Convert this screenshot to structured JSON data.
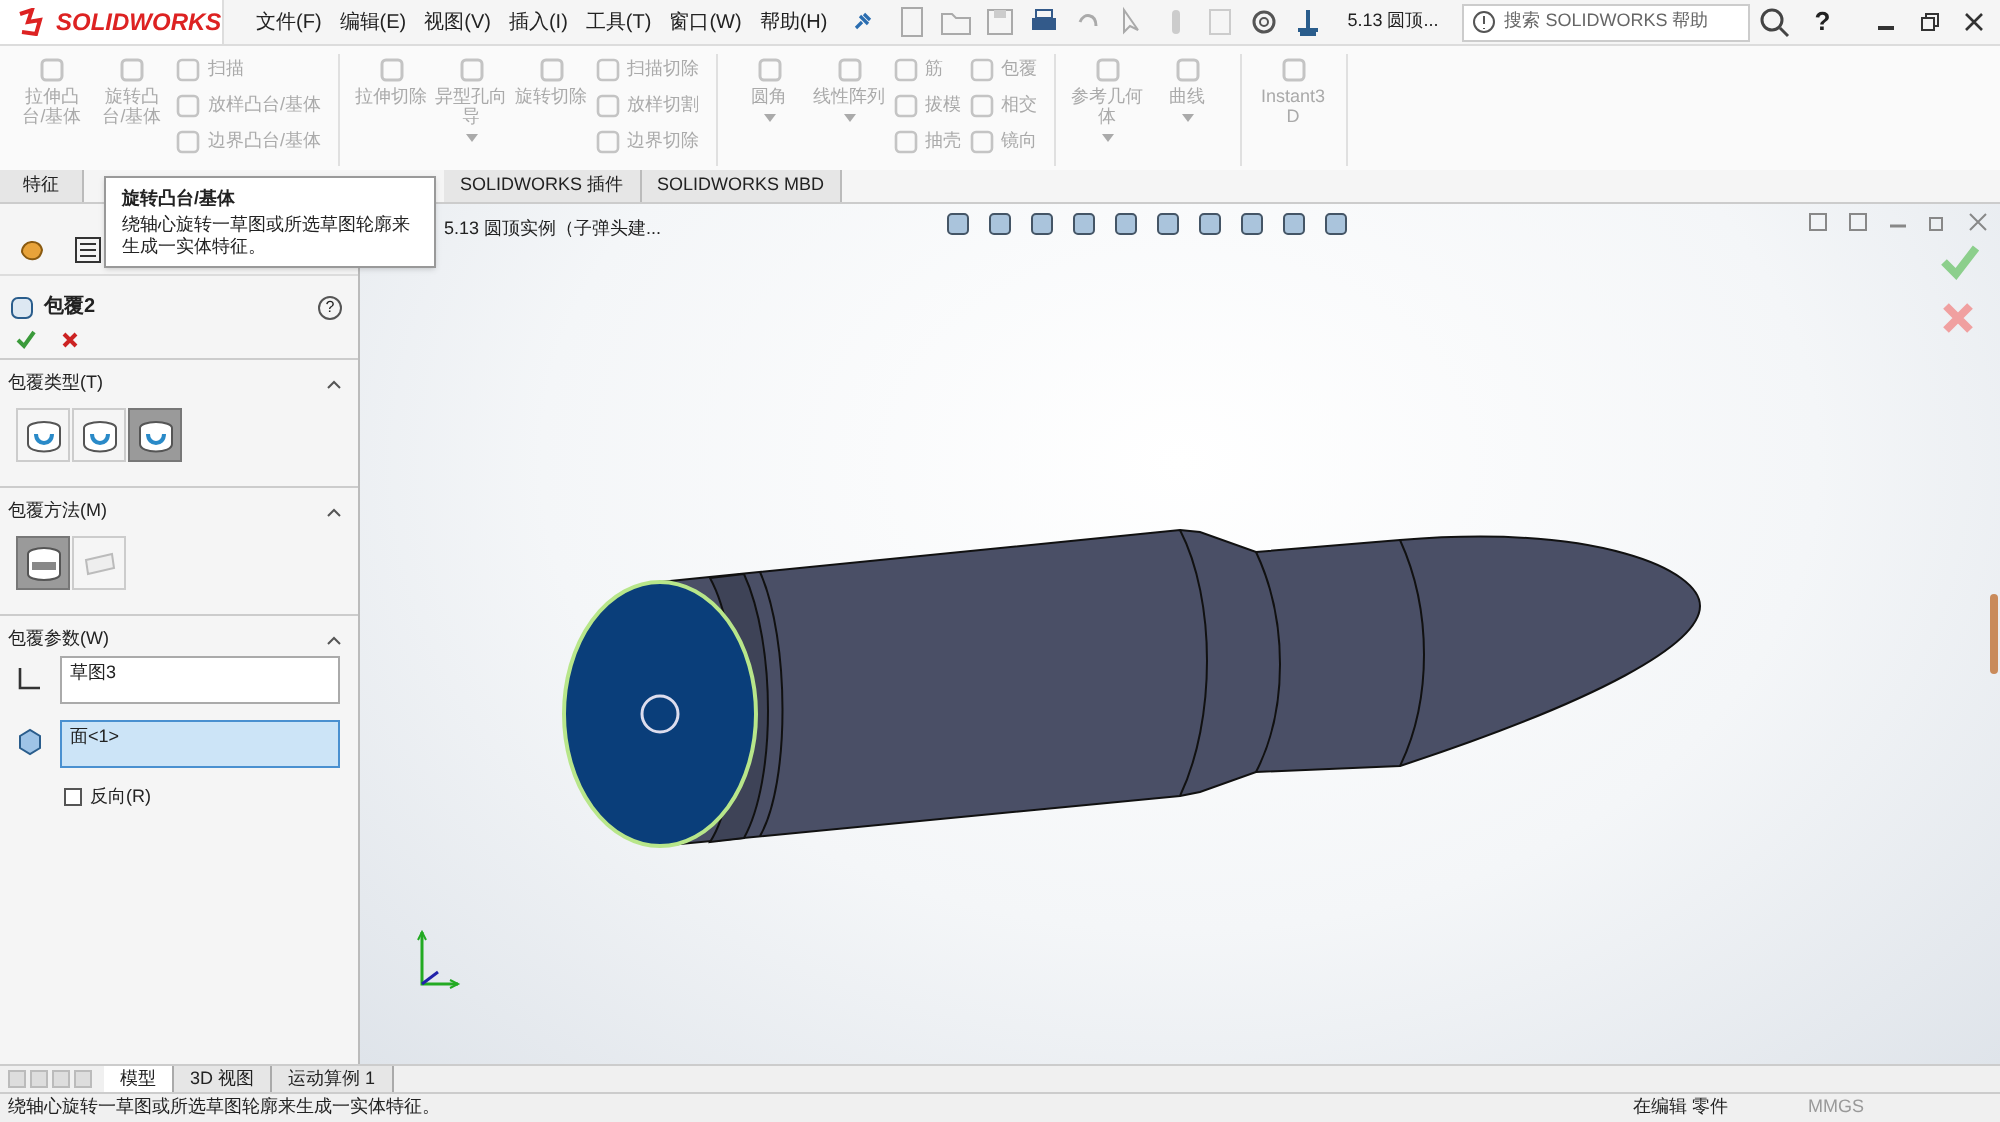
{
  "app": {
    "logo": "SOLIDWORKS",
    "menus": [
      "文件(F)",
      "编辑(E)",
      "视图(V)",
      "插入(I)",
      "工具(T)",
      "窗口(W)",
      "帮助(H)"
    ],
    "document_title": "5.13 圆顶...",
    "search": {
      "placeholder": "搜索 SOLIDWORKS 帮助"
    },
    "help": "?"
  },
  "ribbon": {
    "groups": [
      {
        "items": [
          {
            "kind": "large",
            "label": "拉伸凸台/基体",
            "disabled": true
          },
          {
            "kind": "large",
            "label": "旋转凸台/基体",
            "disabled": true
          },
          {
            "kind": "column",
            "children": [
              {
                "label": "扫描",
                "disabled": true
              },
              {
                "label": "放样凸台/基体",
                "disabled": true
              },
              {
                "label": "边界凸台/基体",
                "disabled": true
              }
            ]
          }
        ]
      },
      {
        "items": [
          {
            "kind": "large",
            "label": "拉伸切除",
            "disabled": true
          },
          {
            "kind": "large",
            "label": "异型孔向导",
            "disabled": true,
            "dropdown": true
          },
          {
            "kind": "large",
            "label": "旋转切除",
            "disabled": true
          },
          {
            "kind": "column",
            "children": [
              {
                "label": "扫描切除",
                "disabled": true
              },
              {
                "label": "放样切割",
                "disabled": true
              },
              {
                "label": "边界切除",
                "disabled": true
              }
            ]
          }
        ]
      },
      {
        "items": [
          {
            "kind": "large",
            "label": "圆角",
            "disabled": true,
            "dropdown": true
          },
          {
            "kind": "large",
            "label": "线性阵列",
            "disabled": true,
            "dropdown": true
          },
          {
            "kind": "column",
            "children": [
              {
                "label": "筋",
                "disabled": true
              },
              {
                "label": "拔模",
                "disabled": true
              },
              {
                "label": "抽壳",
                "disabled": true
              }
            ]
          },
          {
            "kind": "column",
            "children": [
              {
                "label": "包覆",
                "disabled": true
              },
              {
                "label": "相交",
                "disabled": true
              },
              {
                "label": "镜向",
                "disabled": true
              }
            ]
          }
        ]
      },
      {
        "items": [
          {
            "kind": "large",
            "label": "参考几何体",
            "disabled": true,
            "dropdown": true
          },
          {
            "kind": "large",
            "label": "曲线",
            "disabled": true,
            "dropdown": true
          }
        ]
      },
      {
        "items": [
          {
            "kind": "large",
            "label": "Instant3D",
            "disabled": true
          }
        ]
      }
    ]
  },
  "tabs": [
    {
      "label": "特征",
      "selected": false
    },
    {
      "label": "SOLIDWORKS 插件",
      "selected": false
    },
    {
      "label": "SOLIDWORKS MBD",
      "selected": false
    }
  ],
  "tooltip": {
    "title": "旋转凸台/基体",
    "text": "绕轴心旋转一草图或所选草图轮廓来生成一实体特征。"
  },
  "property_manager": {
    "title": "包覆2",
    "help": "?",
    "sections": [
      {
        "kind": "buttons",
        "title": "包覆类型(T)",
        "expanded": true,
        "options": [
          {
            "selected": false
          },
          {
            "selected": false
          },
          {
            "selected": true
          }
        ]
      },
      {
        "kind": "buttons",
        "title": "包覆方法(M)",
        "expanded": true,
        "options": [
          {
            "selected": true
          },
          {
            "selected": false
          }
        ]
      },
      {
        "kind": "params",
        "title": "包覆参数(W)",
        "expanded": true,
        "fields": [
          {
            "value": "草图3",
            "selected": false
          },
          {
            "value": "面<1>",
            "selected": true
          }
        ],
        "checkbox": {
          "label": "反向(R)",
          "checked": false
        }
      }
    ]
  },
  "viewport": {
    "breadcrumb": "5.13 圆顶实例（子弹头建..."
  },
  "bottom_tabs": [
    {
      "label": "模型",
      "selected": true
    },
    {
      "label": "3D 视图",
      "selected": false
    },
    {
      "label": "运动算例 1",
      "selected": false
    }
  ],
  "status_bar": {
    "message": "绕轴心旋转一草图或所选草图轮廓来生成一实体特征。",
    "mode": "在编辑 零件",
    "units": "MMGS"
  }
}
